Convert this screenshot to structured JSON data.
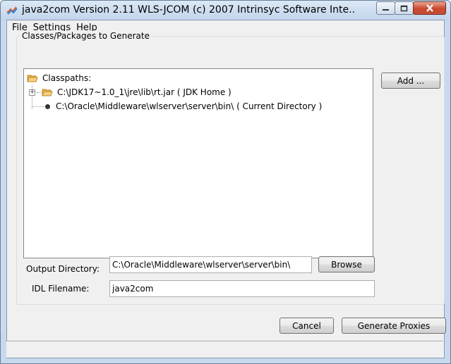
{
  "window": {
    "title": "java2com Version 2.11 WLS-JCOM (c) 2007 Intrinsyc Software Inte...",
    "icon": "java-cup-arrow-icon"
  },
  "menu": [
    "File",
    "Settings",
    "Help"
  ],
  "group": {
    "legend": "Classes/Packages to Generate"
  },
  "tree": {
    "root_label": "Classpaths:",
    "items": [
      {
        "label": "C:\\JDK17~1.0_1\\jre\\lib\\rt.jar ( JDK Home )",
        "type": "jar-folder",
        "expandable": true
      },
      {
        "label": "C:\\Oracle\\Middleware\\wlserver\\server\\bin\\ ( Current Directory )",
        "type": "directory",
        "expandable": false
      }
    ]
  },
  "buttons": {
    "add": "Add ...",
    "browse": "Browse",
    "cancel": "Cancel",
    "generate": "Generate Proxies"
  },
  "fields": {
    "output_label": "Output Directory:",
    "output_value": "C:\\Oracle\\Middleware\\wlserver\\server\\bin\\",
    "idl_label": "IDL Filename:",
    "idl_value": "java2com"
  },
  "status": ""
}
